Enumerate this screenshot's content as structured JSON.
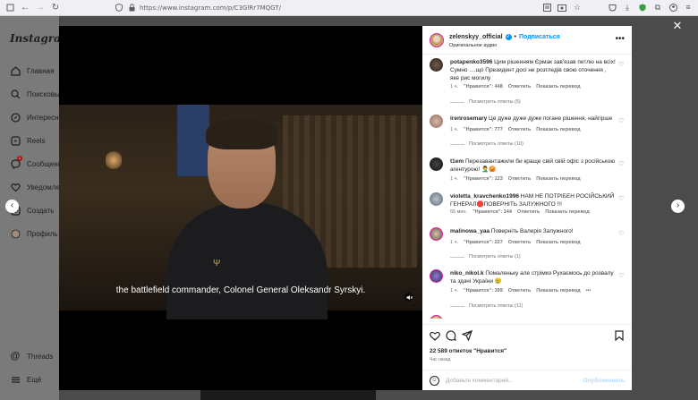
{
  "browser": {
    "url": "https://www.instagram.com/p/C3GlRr7MQGT/"
  },
  "sidebar": {
    "logo": "Instagram",
    "items": [
      {
        "label": "Главная",
        "icon": "home-icon"
      },
      {
        "label": "Поисковы",
        "icon": "search-icon"
      },
      {
        "label": "Интересно",
        "icon": "compass-icon"
      },
      {
        "label": "Reels",
        "icon": "reels-icon"
      },
      {
        "label": "Сообщени",
        "icon": "messenger-icon",
        "badge": "1"
      },
      {
        "label": "Уведомле",
        "icon": "heart-icon"
      },
      {
        "label": "Создать",
        "icon": "plus-icon"
      },
      {
        "label": "Профиль",
        "icon": "profile-icon"
      }
    ],
    "bottom": [
      {
        "label": "Threads",
        "icon": "threads-icon"
      },
      {
        "label": "Ещё",
        "icon": "menu-icon"
      }
    ]
  },
  "video": {
    "subtitle": "the battlefield commander, Colonel General Oleksandr Syrskyi."
  },
  "post": {
    "username": "zelenskyy_official",
    "follow_label": "Подписаться",
    "audio": "Оригинальное аудио",
    "likes": "22 589 отметок \"Нравится\"",
    "time_ago": "Час назад",
    "comment_placeholder": "Добавьте комментарий...",
    "publish_label": "Опубликовать"
  },
  "comments": [
    {
      "user": "potapenko3596",
      "text": "Цим рішенням Єрмак зав'язав петлю на всіх! Сумно ....що Президент досі не розгледів свою оточення , яке рис могилу",
      "time": "1 ч.",
      "likes": "\"Нравится\": 448",
      "reply": "Ответить",
      "translate": "Показать перевод",
      "replies": "Посмотреть ответы (5)"
    },
    {
      "user": "irenrosemary",
      "text": "Це дуже дуже дуже погане рішення, найгірше",
      "time": "1 ч.",
      "likes": "\"Нравится\": 777",
      "reply": "Ответить",
      "translate": "Показать перевод",
      "replies": "Посмотреть ответы (10)"
    },
    {
      "user": "t1em",
      "text": "Перезавантажили би краще свій свій офіс з російською агентурою! 🤦‍♂️😡",
      "time": "1 ч.",
      "likes": "\"Нравится\": 123",
      "reply": "Ответить",
      "translate": "Показать перевод",
      "replies": ""
    },
    {
      "user": "violetta_kravchenko1996",
      "text": "НАМ НЕ ПОТРІБЕН РОСІЙСЬКИЙ ГЕНЕРАЛ🛑ПОВЕРНІТЬ ЗАЛУЖНОГО !!!",
      "time": "55 мин.",
      "likes": "\"Нравится\": 144",
      "reply": "Ответить",
      "translate": "Показать перевод",
      "replies": ""
    },
    {
      "user": "malinowa_yaa",
      "text": "Поверніть Валерія Залужного!",
      "time": "1 ч.",
      "likes": "\"Нравится\": 227",
      "reply": "Ответить",
      "translate": "Показать перевод",
      "replies": "Посмотреть ответы (1)"
    },
    {
      "user": "niko_nikol.k",
      "text": "Помаленьку але стрімко Рухаємось до розвалу та здачі України 😢",
      "time": "1 ч.",
      "likes": "\"Нравится\": 399",
      "reply": "Ответить",
      "translate": "Показать перевод",
      "more": "•••",
      "replies": "Посмотреть ответы (11)"
    }
  ]
}
